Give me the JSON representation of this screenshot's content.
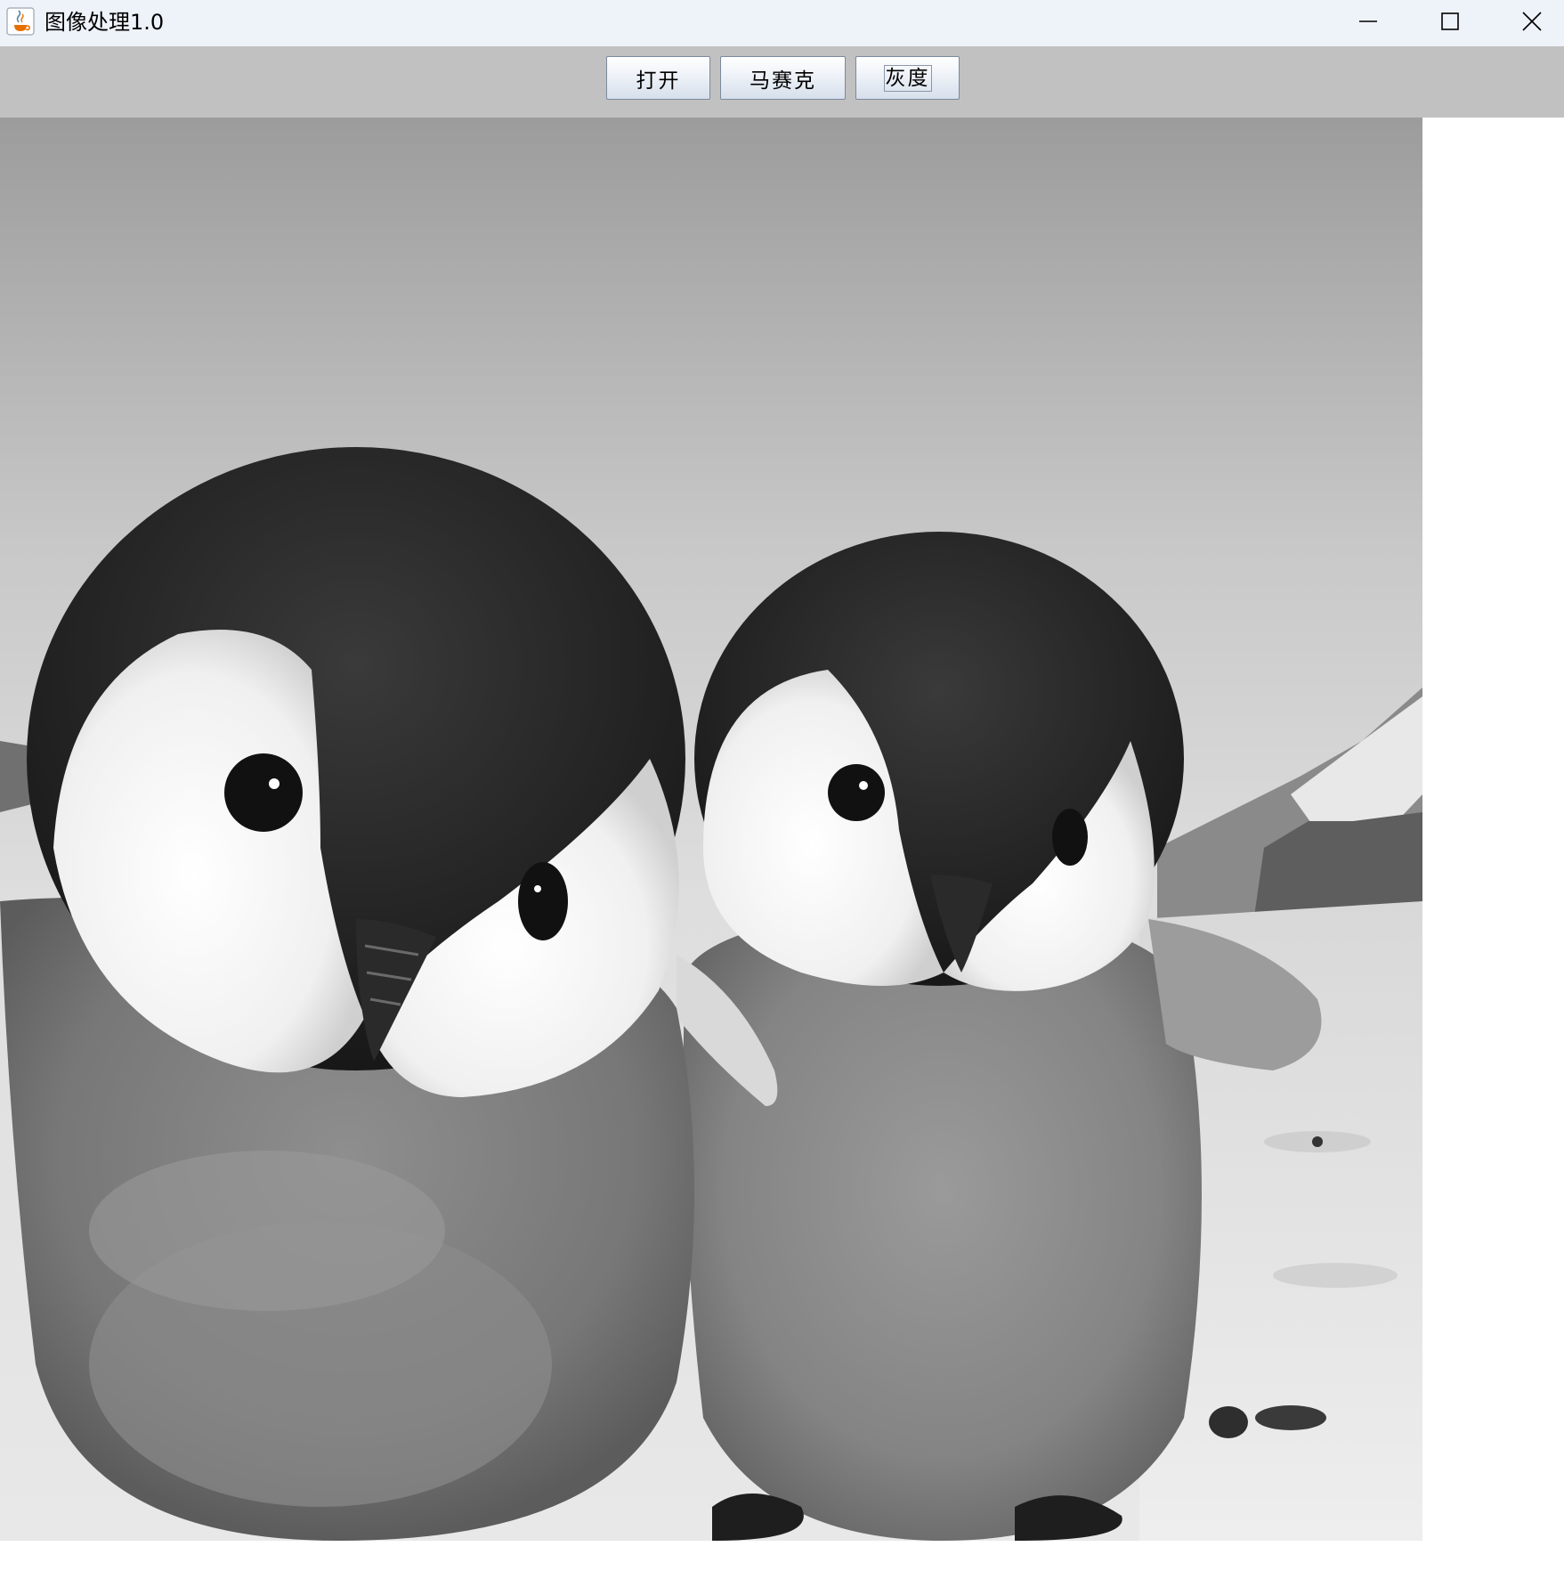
{
  "window": {
    "title": "图像处理1.0",
    "icon": "java-coffee-icon",
    "controls": [
      "minimize-icon",
      "maximize-icon",
      "close-icon"
    ]
  },
  "toolbar": {
    "buttons": [
      {
        "label": "打开"
      },
      {
        "label": "马赛克"
      },
      {
        "label": "灰度"
      }
    ],
    "background": "#c1c1c1"
  },
  "image_panel": {
    "content": "grayscale-photo",
    "accent_colors": {
      "titlebar": "#eef3fa",
      "panel": "#ffffff"
    }
  }
}
